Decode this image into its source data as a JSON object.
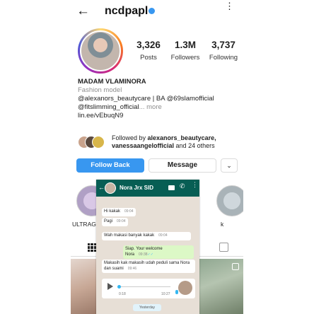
{
  "topbar": {
    "back_icon": "back-arrow-icon",
    "username": "ncdpapl",
    "verified_color": "#3897f0",
    "more_icon": "more-vertical-icon"
  },
  "stats": {
    "posts": {
      "value": "3,326",
      "label": "Posts"
    },
    "followers": {
      "value": "1.3M",
      "label": "Followers"
    },
    "following": {
      "value": "3,737",
      "label": "Following"
    }
  },
  "bio": {
    "name": "MADAM VLAMINORA",
    "category": "Fashion model",
    "line1": "@alexanors_beautycare | BA @69slamofficial",
    "line2_text": "@fitslimming_official",
    "line2_more": "... more",
    "link": "lin.ee/vEbuqN9"
  },
  "followed_by": {
    "prefix": "Followed by ",
    "user1": "alexanors_beautycare,",
    "user2": "vanessaangelofficial",
    "suffix": " and 24 others"
  },
  "actions": {
    "follow_back": "Follow Back",
    "message": "Message",
    "suggest_icon": "chevron-down-icon"
  },
  "highlights": [
    {
      "label": "ULTRAG"
    },
    {
      "label": "k"
    }
  ],
  "whatsapp": {
    "header_color": "#075e54",
    "contact_name": "Nora Jrx SID",
    "messages": [
      {
        "text": "Hi kakak",
        "time": "09:04",
        "dir": "in"
      },
      {
        "text": "Pagi",
        "time": "09:04",
        "dir": "in"
      },
      {
        "text": "Wah makasi banyak kakak",
        "time": "09:04",
        "dir": "in"
      },
      {
        "text": "Siap. Your welcome Nora",
        "time": "09:38",
        "dir": "out"
      },
      {
        "text": "Makasih kak makasih udah peduli sama Nora dan suami",
        "time": "09:46",
        "dir": "in"
      }
    ],
    "voice_note": {
      "duration": "0:18",
      "time": "10:27"
    },
    "date_chip": "Yesterday"
  }
}
